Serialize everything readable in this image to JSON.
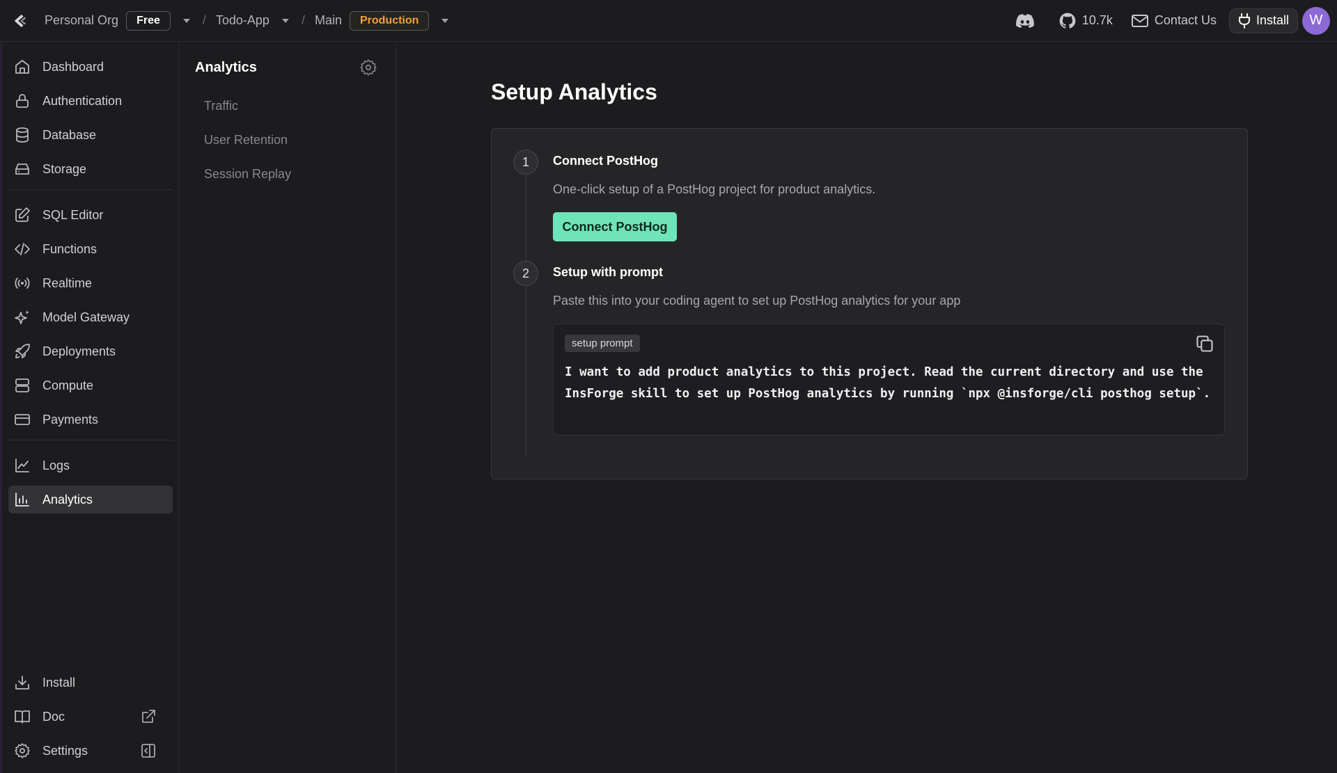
{
  "topbar": {
    "org_name": "Personal Org",
    "plan": "Free",
    "project": "Todo-App",
    "branch": "Main",
    "environment": "Production",
    "github_stars": "10.7k",
    "contact_label": "Contact Us",
    "install_label": "Install",
    "avatar_initial": "W"
  },
  "sidebar": {
    "items": [
      {
        "label": "Dashboard",
        "icon": "home-icon"
      },
      {
        "label": "Authentication",
        "icon": "lock-icon"
      },
      {
        "label": "Database",
        "icon": "database-icon"
      },
      {
        "label": "Storage",
        "icon": "storage-icon"
      },
      {
        "label": "SQL Editor",
        "icon": "edit-icon"
      },
      {
        "label": "Functions",
        "icon": "code-icon"
      },
      {
        "label": "Realtime",
        "icon": "broadcast-icon"
      },
      {
        "label": "Model Gateway",
        "icon": "sparkle-icon"
      },
      {
        "label": "Deployments",
        "icon": "rocket-icon"
      },
      {
        "label": "Compute",
        "icon": "server-icon"
      },
      {
        "label": "Payments",
        "icon": "card-icon"
      },
      {
        "label": "Logs",
        "icon": "chart-line-icon"
      },
      {
        "label": "Analytics",
        "icon": "bar-chart-icon",
        "active": true
      }
    ],
    "bottom": [
      {
        "label": "Install",
        "icon": "download-icon"
      },
      {
        "label": "Doc",
        "icon": "book-icon"
      },
      {
        "label": "Settings",
        "icon": "gear-icon"
      }
    ]
  },
  "subnav": {
    "title": "Analytics",
    "items": [
      "Traffic",
      "User Retention",
      "Session Replay"
    ]
  },
  "main": {
    "title": "Setup Analytics",
    "steps": [
      {
        "number": "1",
        "title": "Connect PostHog",
        "description": "One-click setup of a PostHog project for product analytics.",
        "button_label": "Connect PostHog"
      },
      {
        "number": "2",
        "title": "Setup with prompt",
        "description": "Paste this into your coding agent to set up PostHog analytics for your app",
        "code_tag": "setup prompt",
        "code_text": "I want to add product analytics to this project. Read the current directory and use the InsForge skill to set up PostHog analytics by running `npx @insforge/cli posthog setup`."
      }
    ]
  },
  "colors": {
    "accent": "#6fe3b9",
    "production": "#f0a13a",
    "avatar": "#8b6ad6"
  }
}
